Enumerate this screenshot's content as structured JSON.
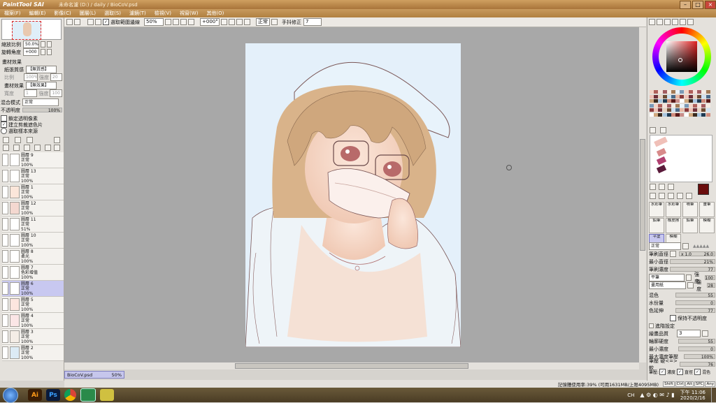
{
  "title": {
    "app": "PaintTool SAI",
    "document": "未命名濾 (D:) / daily / BioCoV.psd"
  },
  "menu": [
    "檔案(F)",
    "編輯(E)",
    "影像(C)",
    "圖層(L)",
    "選取(S)",
    "濾鏡(T)",
    "檢視(V)",
    "視窗(W)",
    "其他(O)"
  ],
  "toolbar": {
    "select_edge": "選取範圍邊線",
    "zoom": "50%",
    "angle": "+000°",
    "blend": "正常",
    "stabilizer_label": "手抖修正",
    "stabilizer": "7"
  },
  "navigator": {
    "zoom_label": "縮放比例",
    "zoom": "50.0%",
    "angle_label": "旋轉角度",
    "angle": "+000"
  },
  "paper": {
    "section": "畫材效果",
    "texture_label": "紙張質感",
    "texture": "【無質感】",
    "scale_label": "比例",
    "scale": "100%",
    "strength_label": "強度",
    "strength": "20",
    "effect_label": "畫材效果",
    "effect": "【無效果】",
    "width_label": "寬度",
    "width": "1",
    "intensity_label": "強度",
    "intensity": "100"
  },
  "layer_props": {
    "blend_label": "混合模式",
    "blend": "正常",
    "opacity_label": "不透明度",
    "opacity": "100%",
    "opt1": "鎖定透明像素",
    "opt2": "建立剪裁遮色片",
    "opt3": "選取樣本來源"
  },
  "layers": [
    {
      "name": "圖層 9",
      "mode": "正常",
      "opacity": "100%",
      "sel": false
    },
    {
      "name": "圖層 13",
      "mode": "正常",
      "opacity": "100%",
      "sel": false
    },
    {
      "name": "圖層 1",
      "mode": "正常",
      "opacity": "100%",
      "sel": false
    },
    {
      "name": "圖層 12",
      "mode": "正常",
      "opacity": "100%",
      "sel": false
    },
    {
      "name": "圖層 11",
      "mode": "正常",
      "opacity": "51%",
      "sel": false
    },
    {
      "name": "圖層 10",
      "mode": "正常",
      "opacity": "100%",
      "sel": false
    },
    {
      "name": "圖層 8",
      "mode": "柔光",
      "opacity": "100%",
      "sel": false
    },
    {
      "name": "圖層 7",
      "mode": "色彩增值",
      "opacity": "100%",
      "sel": false
    },
    {
      "name": "圖層 6",
      "mode": "正常",
      "opacity": "100%",
      "sel": true
    },
    {
      "name": "圖層 5",
      "mode": "正常",
      "opacity": "100%",
      "sel": false
    },
    {
      "name": "圖層 4",
      "mode": "正常",
      "opacity": "100%",
      "sel": false
    },
    {
      "name": "圖層 3",
      "mode": "正常",
      "opacity": "100%",
      "sel": false
    },
    {
      "name": "圖層 2",
      "mode": "正常",
      "opacity": "100%",
      "sel": false
    }
  ],
  "doc_tab": {
    "name": "BioCoV.psd",
    "zoom": "50%"
  },
  "status": {
    "memory": "記憶體使用率:39% (可用1631MB/上限4095MB)",
    "keys": [
      "Shift",
      "Ctrl",
      "Alt",
      "SPC",
      "Any"
    ]
  },
  "brush_tools": [
    "水彩筆",
    "水彩筆",
    "噴筆",
    "畫筆",
    "鉛筆",
    "橡皮擦",
    "鉛筆",
    "模糊",
    "平塗",
    "模糊"
  ],
  "brush": {
    "mode": "正常",
    "size_label": "筆刷直徑",
    "size_mult": "x 1.0",
    "size": "26.0",
    "min_size_label": "最小直徑",
    "min_size": "21%",
    "density_label": "筆刷濃度",
    "density": "77",
    "shape": "平筆",
    "shape_strength_label": "強度",
    "shape_strength": "100",
    "texture": "畫用紙",
    "texture_strength_label": "強度",
    "texture_strength": "28",
    "blend_label": "混色",
    "blend": "55",
    "dilution_label": "水份量",
    "dilution": "0",
    "persistence_label": "色延伸",
    "persistence": "77",
    "keep_opacity": "保持不透明度",
    "advanced": "進階設定",
    "quality_label": "繪畫品質",
    "quality": "3",
    "edge_label": "輪廓硬度",
    "edge": "55",
    "min_density_label": "最小濃度",
    "min_density": "0",
    "max_density_label": "最大濃度筆壓",
    "max_density": "100%",
    "hardsoft_label": "筆壓 硬<=>軟",
    "hardsoft": "76",
    "pressure_label": "筆壓:",
    "p_density": "濃度",
    "p_size": "直徑",
    "p_blend": "混色"
  },
  "taskbar": {
    "lang": "CH",
    "time": "下午 11:06",
    "date": "2020/2/16",
    "apps": [
      "Ai",
      "Ps"
    ]
  },
  "colors": {
    "primary": "#6a0d0d",
    "secondary": "#ffffff",
    "selected_layer": "#c8c8f0"
  }
}
